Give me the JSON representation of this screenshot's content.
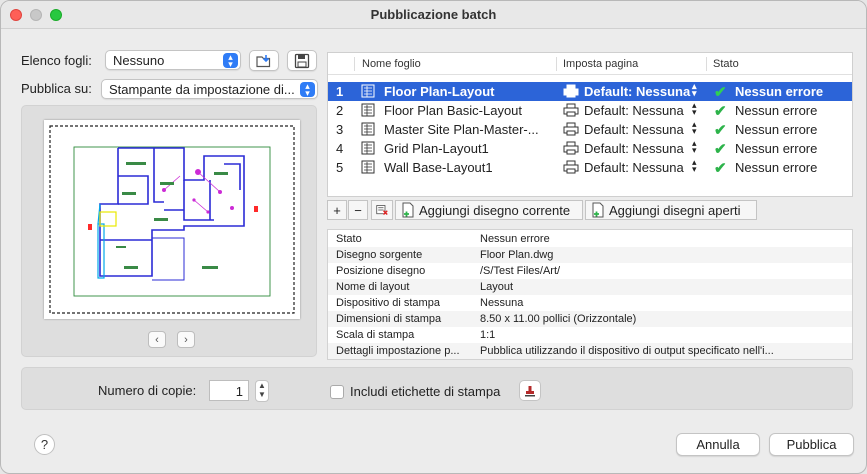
{
  "window": {
    "title": "Pubblicazione batch"
  },
  "sheet_list": {
    "label": "Elenco fogli:",
    "value": "Nessuno"
  },
  "publish_to": {
    "label": "Pubblica su:",
    "value": "Stampante da impostazione di..."
  },
  "table": {
    "columns": [
      "Nome foglio",
      "Imposta pagina",
      "Stato"
    ],
    "rows": [
      {
        "num": "1",
        "name": "Floor Plan-Layout",
        "page": "Default: Nessuna",
        "status": "Nessun errore",
        "selected": true
      },
      {
        "num": "2",
        "name": "Floor Plan Basic-Layout",
        "page": "Default: Nessuna",
        "status": "Nessun errore",
        "selected": false
      },
      {
        "num": "3",
        "name": "Master Site Plan-Master-...",
        "page": "Default: Nessuna",
        "status": "Nessun errore",
        "selected": false
      },
      {
        "num": "4",
        "name": "Grid Plan-Layout1",
        "page": "Default: Nessuna",
        "status": "Nessun errore",
        "selected": false
      },
      {
        "num": "5",
        "name": "Wall Base-Layout1",
        "page": "Default: Nessuna",
        "status": "Nessun errore",
        "selected": false
      }
    ]
  },
  "toolbar": {
    "add_current": "Aggiungi disegno corrente",
    "add_open": "Aggiungi disegni aperti"
  },
  "details": [
    {
      "key": "Stato",
      "value": "Nessun errore"
    },
    {
      "key": "Disegno sorgente",
      "value": "Floor Plan.dwg"
    },
    {
      "key": "Posizione disegno",
      "value": "/S/Test Files/Art/"
    },
    {
      "key": "Nome di layout",
      "value": "Layout"
    },
    {
      "key": "Dispositivo di stampa",
      "value": "Nessuna"
    },
    {
      "key": "Dimensioni di stampa",
      "value": "8.50 x 11.00 pollici (Orizzontale)"
    },
    {
      "key": "Scala di stampa",
      "value": "1:1"
    },
    {
      "key": "Dettagli impostazione p...",
      "value": "Pubblica utilizzando il dispositivo di output specificato nell'i..."
    }
  ],
  "copies": {
    "label": "Numero di copie:",
    "value": "1"
  },
  "stamp": {
    "label": "Includi etichette di stampa"
  },
  "buttons": {
    "help": "?",
    "cancel": "Annulla",
    "publish": "Pubblica"
  },
  "colors": {
    "accent": "#2c64d8",
    "ok_green": "#2db34a"
  }
}
